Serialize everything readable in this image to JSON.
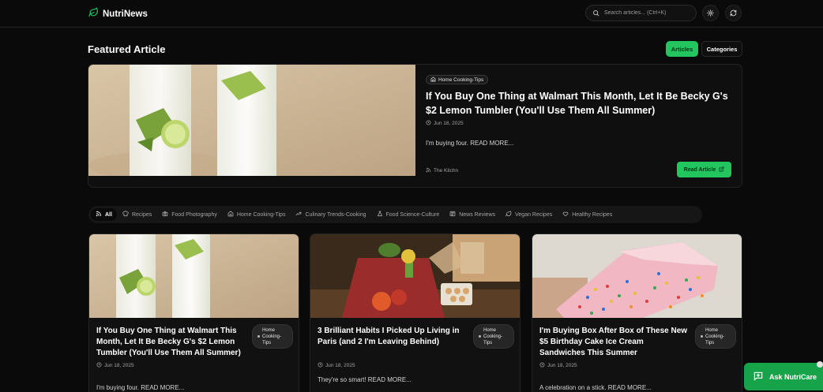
{
  "app": {
    "name": "NutriNews"
  },
  "header": {
    "search_placeholder": "Search articles... (Ctrl+K)"
  },
  "featured": {
    "section_title": "Featured Article",
    "toggle": {
      "articles": "Articles",
      "categories": "Categories",
      "active": "Articles"
    },
    "article": {
      "category": "Home Cooking-Tips",
      "title": "If You Buy One Thing at Walmart This Month, Let It Be Becky G's $2 Lemon Tumbler (You'll Use Them All Summer)",
      "date": "Jun 18, 2025",
      "excerpt": "I'm buying four. READ MORE...",
      "source": "The Kitchn",
      "read_label": "Read Article"
    }
  },
  "categories": [
    {
      "label": "All",
      "icon": "rss-icon",
      "active": true
    },
    {
      "label": "Recipes",
      "icon": "chef-hat-icon",
      "active": false
    },
    {
      "label": "Food Photography",
      "icon": "camera-icon",
      "active": false
    },
    {
      "label": "Home Cooking-Tips",
      "icon": "home-icon",
      "active": false
    },
    {
      "label": "Culinary Trends-Cooking",
      "icon": "trending-icon",
      "active": false
    },
    {
      "label": "Food Science-Culture",
      "icon": "flask-icon",
      "active": false
    },
    {
      "label": "News Reviews",
      "icon": "newspaper-icon",
      "active": false
    },
    {
      "label": "Vegan Recipes",
      "icon": "leaf-icon",
      "active": false
    },
    {
      "label": "Healthy Recipes",
      "icon": "heart-icon",
      "active": false
    }
  ],
  "cards": [
    {
      "title": "If You Buy One Thing at Walmart This Month, Let It Be Becky G's $2 Lemon Tumbler (You'll Use Them All Summer)",
      "badge": [
        "Home",
        "Cooking-",
        "Tips"
      ],
      "date": "Jun 18, 2025",
      "excerpt": "I'm buying four. READ MORE..."
    },
    {
      "title": "3 Brilliant Habits I Picked Up Living in Paris (and 2 I'm Leaving Behind)",
      "badge": [
        "Home",
        "Cooking-",
        "Tips"
      ],
      "date": "Jun 18, 2025",
      "excerpt": "They're so smart! READ MORE..."
    },
    {
      "title": "I'm Buying Box After Box of These New $5 Birthday Cake Ice Cream Sandwiches This Summer",
      "badge": [
        "Home",
        "Cooking-",
        "Tips"
      ],
      "date": "Jun 18, 2025",
      "excerpt": "A celebration on a stick. READ MORE..."
    }
  ],
  "assistant": {
    "label": "Ask NutriCare"
  },
  "colors": {
    "accent": "#22c55e",
    "background": "#0a0a0a",
    "card": "#111111"
  }
}
